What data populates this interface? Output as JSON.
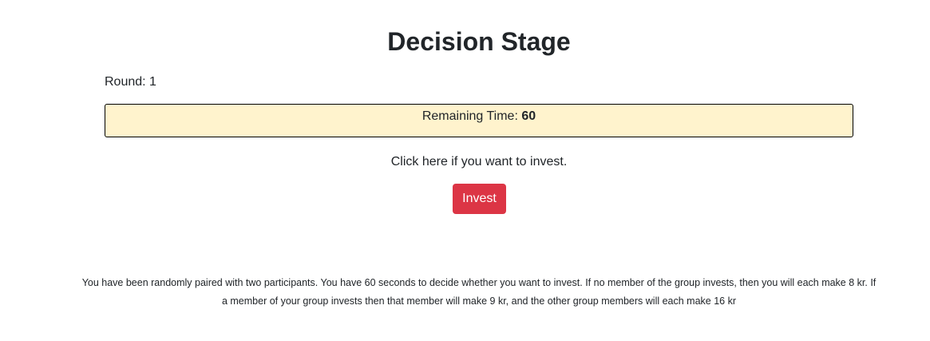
{
  "page": {
    "title": "Decision Stage",
    "round_label": "Round: 1",
    "timer": {
      "label": "Remaining Time: ",
      "value": "60"
    },
    "prompt": "Click here if you want to invest.",
    "invest_button": "Invest",
    "info_text": "You have been randomly paired with two participants. You have 60 seconds to decide whether you want to invest. If no member of the group invests, then you will each make 8 kr. If a member of your group invests then that member will make 9 kr, and the other group members will each make 16 kr"
  },
  "colors": {
    "timer_background": "#fff3cd",
    "button_background": "#dc3545",
    "button_text": "#ffffff",
    "text": "#212529"
  }
}
